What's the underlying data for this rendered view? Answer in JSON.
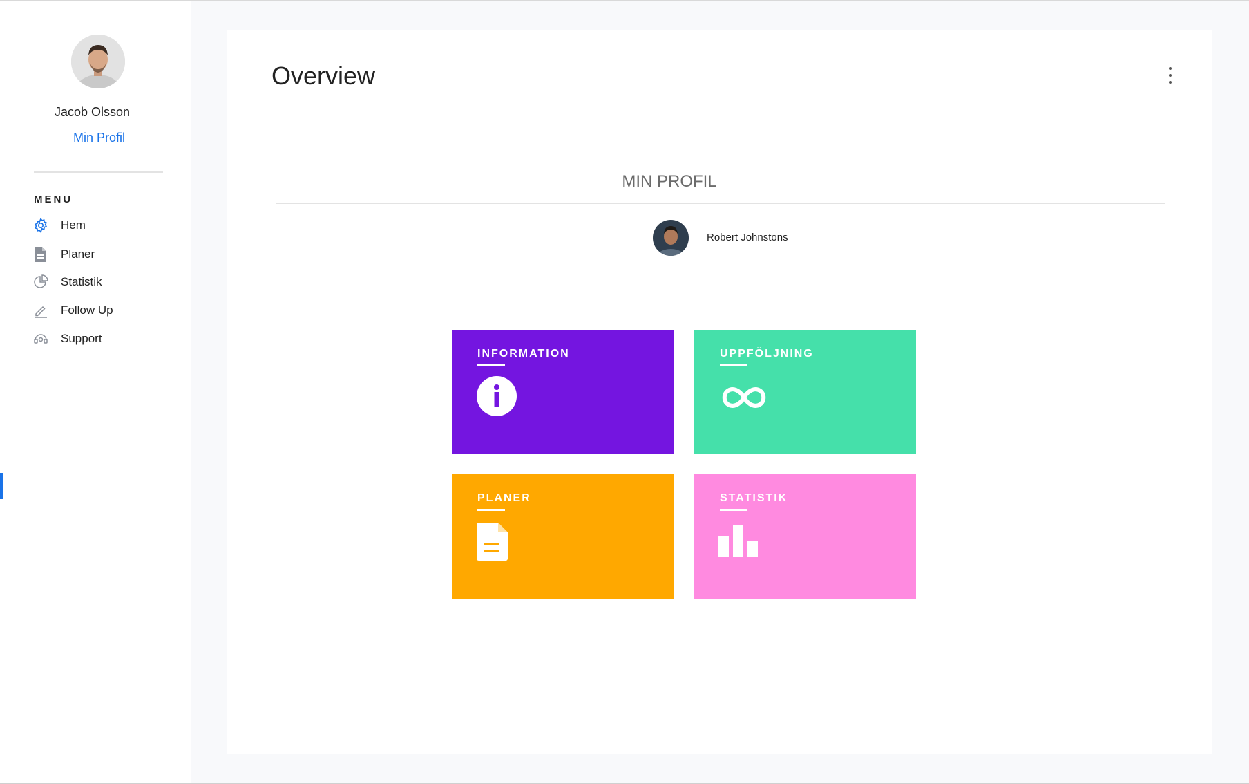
{
  "sidebar": {
    "user_name": "Jacob Olsson",
    "profile_link": "Min Profil",
    "menu_title": "MENU",
    "items": [
      {
        "label": "Hem",
        "icon": "gear-icon"
      },
      {
        "label": "Planer",
        "icon": "document-icon"
      },
      {
        "label": "Statistik",
        "icon": "pie-chart-icon"
      },
      {
        "label": "Follow Up",
        "icon": "pencil-icon"
      },
      {
        "label": "Support",
        "icon": "headset-icon"
      }
    ]
  },
  "main": {
    "title": "Overview",
    "section_title": "MIN PROFIL",
    "person_name": "Robert Johnstons",
    "tiles": [
      {
        "label": "INFORMATION",
        "icon": "info-icon",
        "color": "#7415e0"
      },
      {
        "label": "UPPFÖLJNING",
        "icon": "infinity-icon",
        "color": "#45e0aa"
      },
      {
        "label": "PLANER",
        "icon": "document-icon",
        "color": "#ffa800"
      },
      {
        "label": "STATISTIK",
        "icon": "bar-chart-icon",
        "color": "#ff8ae0"
      }
    ]
  },
  "colors": {
    "accent": "#1a73e8",
    "background": "#f8f9fb"
  }
}
